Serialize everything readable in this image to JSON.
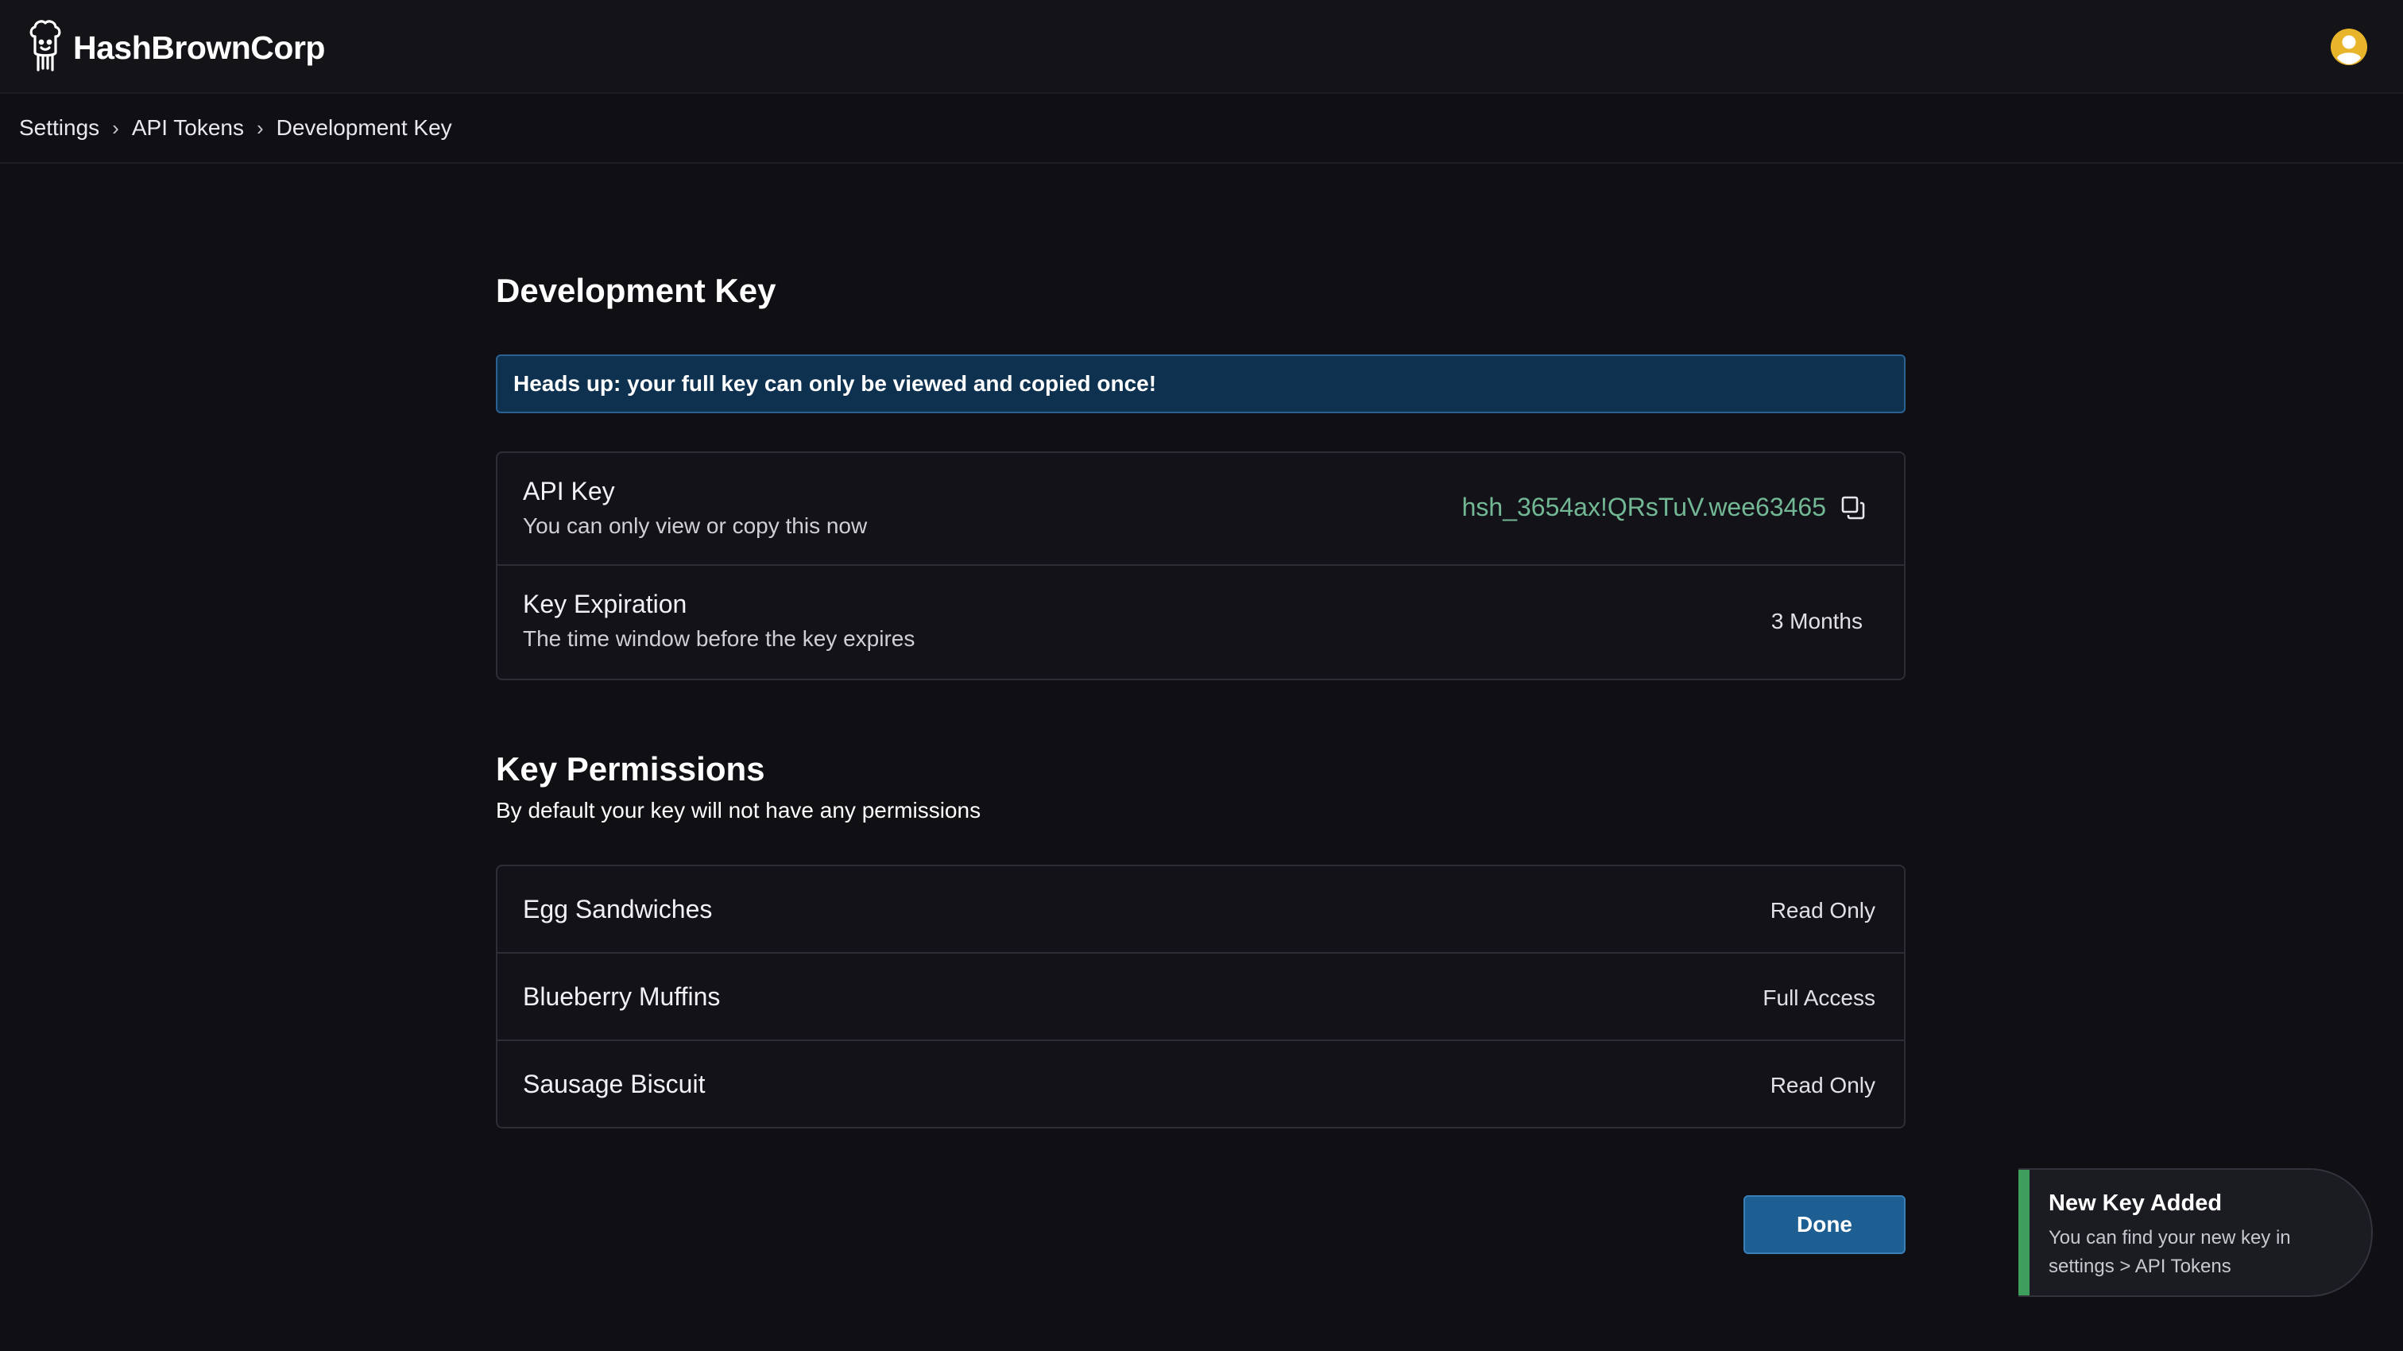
{
  "header": {
    "brand": "HashBrownCorp",
    "logo_icon": "chef-mascot-icon",
    "avatar_icon": "user-avatar-icon",
    "avatar_color": "#e8b52a"
  },
  "breadcrumb": {
    "items": [
      "Settings",
      "API Tokens",
      "Development Key"
    ],
    "separator": "›"
  },
  "page": {
    "title": "Development Key",
    "alert": "Heads up: your full key can only be viewed and copied once!"
  },
  "key_details": {
    "api_key": {
      "title": "API Key",
      "subtitle": "You can only view or copy this now",
      "value": "hsh_3654ax!QRsTuV.wee63465",
      "copy_icon": "copy-icon"
    },
    "expiration": {
      "title": "Key Expiration",
      "subtitle": "The time window before the key expires",
      "value": "3 Months"
    }
  },
  "permissions": {
    "title": "Key Permissions",
    "subtitle": "By default your key will not have any permissions",
    "items": [
      {
        "name": "Egg Sandwiches",
        "access": "Read Only"
      },
      {
        "name": "Blueberry Muffins",
        "access": "Full Access"
      },
      {
        "name": "Sausage Biscuit",
        "access": "Read Only"
      }
    ]
  },
  "actions": {
    "done_label": "Done",
    "done_color": "#1d5e93"
  },
  "toast": {
    "title": "New Key Added",
    "message": "You can find your new key in settings > API Tokens",
    "accent_color": "#3e9e5e"
  }
}
